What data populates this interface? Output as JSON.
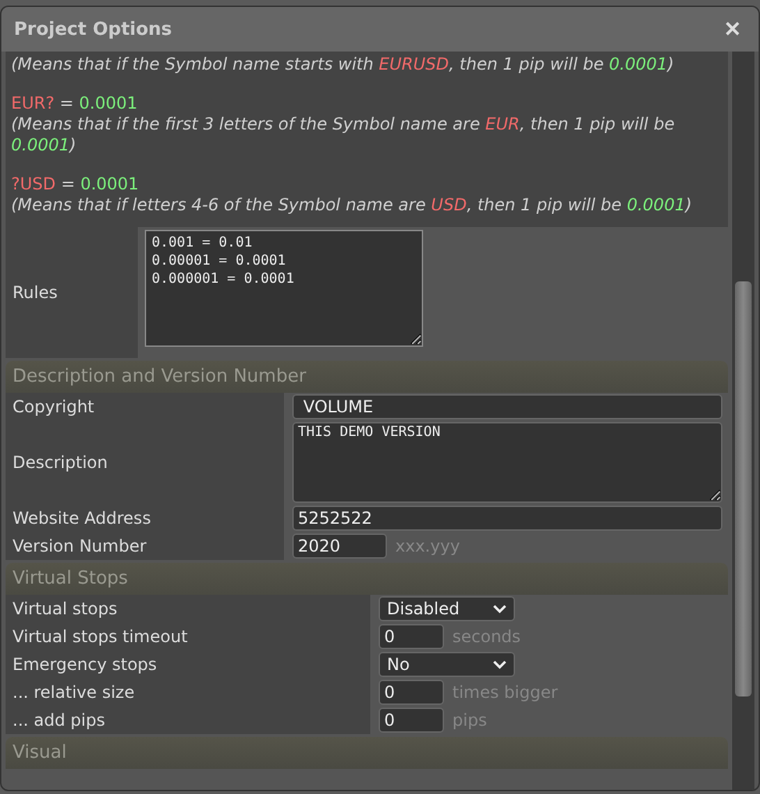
{
  "window": {
    "title": "Project Options",
    "close": "✕"
  },
  "notes": [
    {
      "explanation": [
        {
          "text": "(Means that if the Symbol name starts with ",
          "kind": "plain"
        },
        {
          "text": "EURUSD",
          "kind": "symbol"
        },
        {
          "text": ", then 1 pip will be ",
          "kind": "plain"
        },
        {
          "text": "0.0001",
          "kind": "value"
        },
        {
          "text": ")",
          "kind": "plain"
        }
      ]
    },
    {
      "rule": [
        {
          "text": "EUR?",
          "kind": "symbol"
        },
        {
          "text": " = ",
          "kind": "plain"
        },
        {
          "text": "0.0001",
          "kind": "value"
        }
      ],
      "explanation": [
        {
          "text": "(Means that if the first 3 letters of the Symbol name are ",
          "kind": "plain"
        },
        {
          "text": "EUR",
          "kind": "symbol"
        },
        {
          "text": ", then 1 pip will be ",
          "kind": "plain"
        },
        {
          "text": "0.0001",
          "kind": "value"
        },
        {
          "text": ")",
          "kind": "plain"
        }
      ]
    },
    {
      "rule": [
        {
          "text": "?USD",
          "kind": "symbol"
        },
        {
          "text": " = ",
          "kind": "plain"
        },
        {
          "text": "0.0001",
          "kind": "value"
        }
      ],
      "explanation": [
        {
          "text": "(Means that if letters 4-6 of the Symbol name are ",
          "kind": "plain"
        },
        {
          "text": "USD",
          "kind": "symbol"
        },
        {
          "text": ", then 1 pip will be ",
          "kind": "plain"
        },
        {
          "text": "0.0001",
          "kind": "value"
        },
        {
          "text": ")",
          "kind": "plain"
        }
      ]
    }
  ],
  "rules": {
    "label": "Rules",
    "value": "0.001 = 0.01\n0.00001 = 0.0001\n0.000001 = 0.0001"
  },
  "sections": [
    {
      "title": "Description and Version Number",
      "fields": [
        {
          "kind": "text",
          "label": "Copyright",
          "value": " VOLUME"
        },
        {
          "kind": "textarea",
          "label": "Description",
          "value": "THIS DEMO VERSION"
        },
        {
          "kind": "text",
          "label": "Website Address",
          "value": "5252522"
        },
        {
          "kind": "short",
          "label": "Version Number",
          "value": "2020",
          "unit": "xxx.yyy"
        }
      ]
    },
    {
      "title": "Virtual Stops",
      "fields": [
        {
          "kind": "select",
          "label": "Virtual stops",
          "value": "Disabled"
        },
        {
          "kind": "short",
          "label": "Virtual stops timeout",
          "value": "0",
          "unit": "seconds"
        },
        {
          "kind": "select",
          "label": "Emergency stops",
          "value": "No"
        },
        {
          "kind": "short",
          "label": "... relative size",
          "value": "0",
          "unit": "times bigger"
        },
        {
          "kind": "short",
          "label": "... add pips",
          "value": "0",
          "unit": "pips"
        }
      ]
    },
    {
      "title": "Visual"
    }
  ]
}
